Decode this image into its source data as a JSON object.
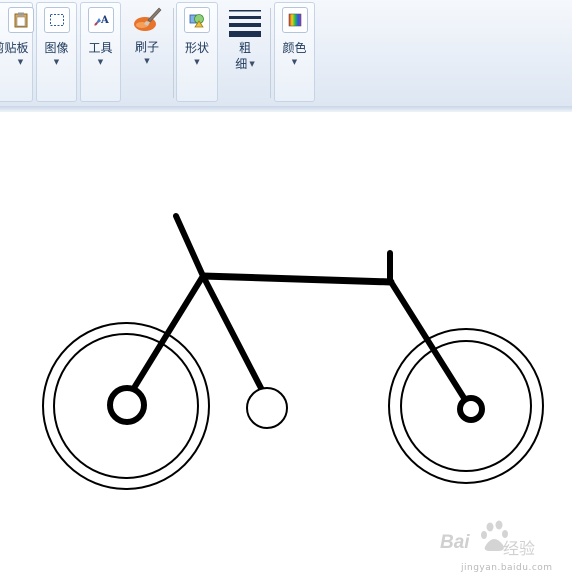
{
  "ribbon": {
    "clipboard": {
      "label": "剪贴板",
      "icon": "clipboard-icon"
    },
    "image": {
      "label": "图像",
      "icon": "select-rect-icon"
    },
    "tools": {
      "label": "工具",
      "icon": "tools-icon"
    },
    "brushes": {
      "label": "刷子",
      "icon": "brush-icon"
    },
    "shapes": {
      "label": "形状",
      "icon": "shapes-icon"
    },
    "size": {
      "label_line1": "粗",
      "label_line2": "细",
      "icon": "line-width-icon"
    },
    "colors": {
      "label": "颜色",
      "icon": "color-palette-icon"
    },
    "dropdown_arrow": "▼"
  },
  "watermark": {
    "brand": "Bai",
    "brand_cn": "经验",
    "url": "jingyan.baidu.com"
  }
}
